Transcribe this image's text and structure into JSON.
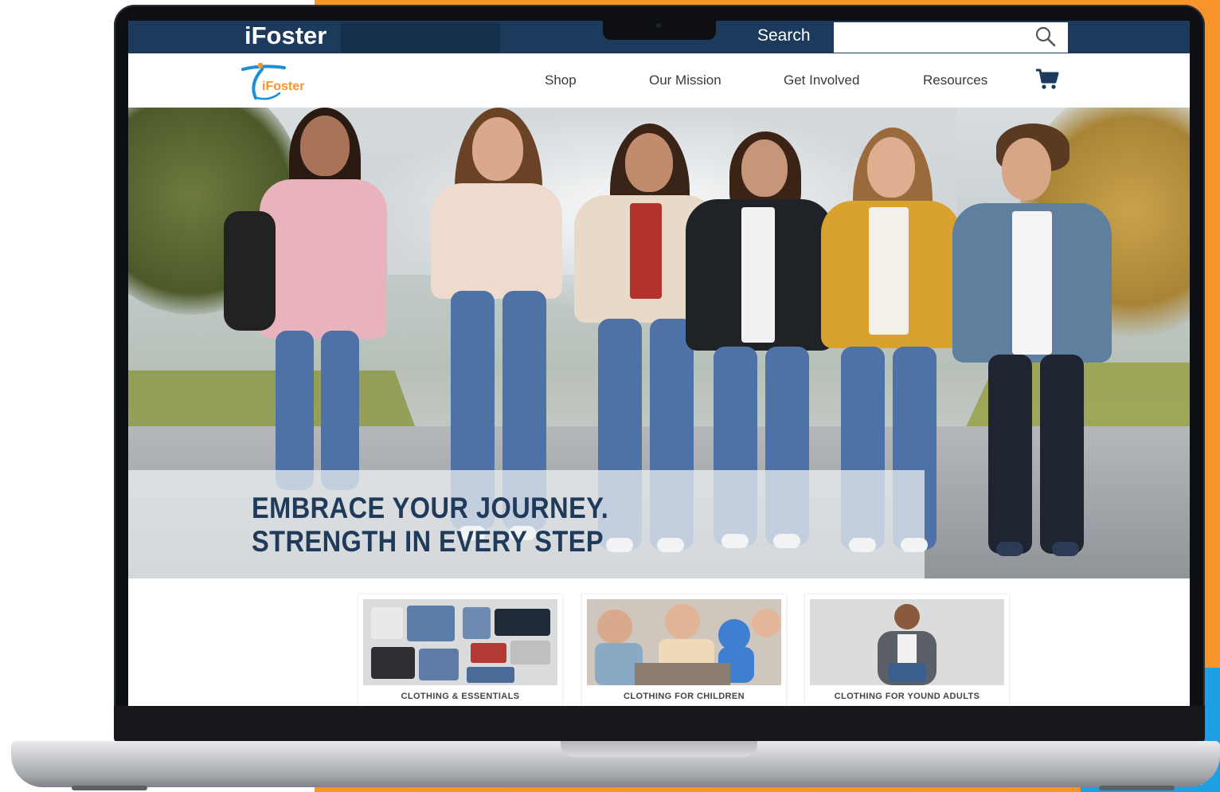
{
  "topbar": {
    "brand": "iFoster",
    "search_label": "Search",
    "search_placeholder": ""
  },
  "nav": {
    "logo_text": "iFoster",
    "items": [
      {
        "label": "Shop"
      },
      {
        "label": "Our Mission"
      },
      {
        "label": "Get Involved"
      },
      {
        "label": "Resources"
      }
    ],
    "icons": {
      "search": "search-icon",
      "cart": "cart-icon"
    }
  },
  "hero": {
    "line1": "EMBRACE YOUR JOURNEY.",
    "line2": "STRENGTH IN EVERY STEP"
  },
  "categories": [
    {
      "label": "CLOTHING & ESSENTIALS"
    },
    {
      "label": "CLOTHING FOR CHILDREN"
    },
    {
      "label": "CLOTHING FOR YOUND ADULTS"
    }
  ],
  "colors": {
    "topbar": "#1b3a5c",
    "accent_orange": "#f7952c",
    "accent_blue": "#1ea0e6",
    "headline": "#1f3a5a"
  }
}
